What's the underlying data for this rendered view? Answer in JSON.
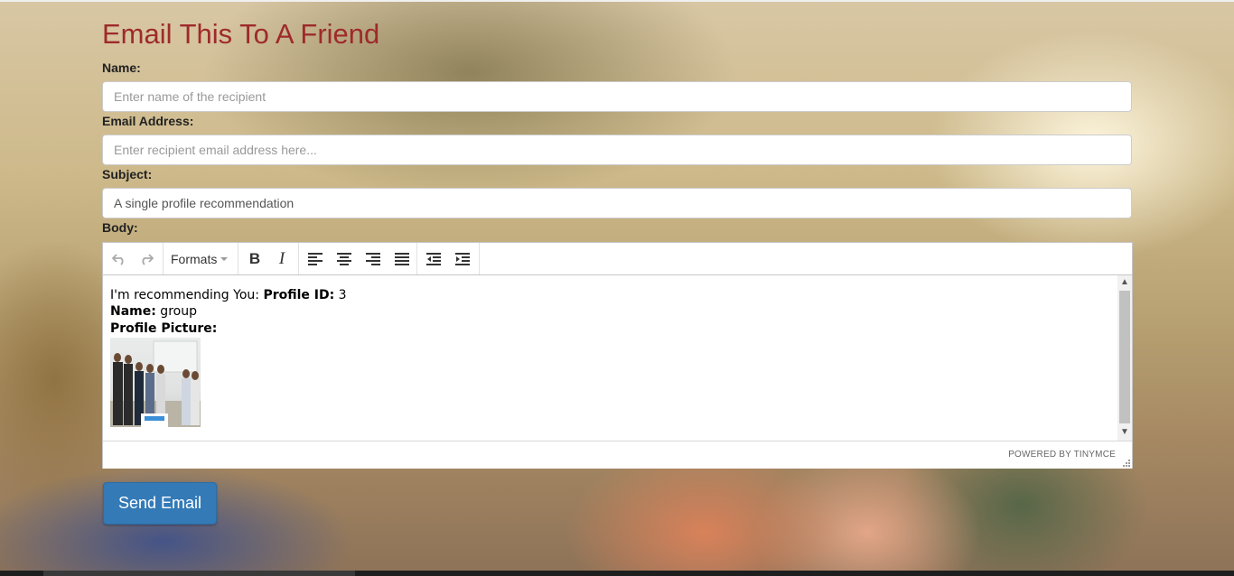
{
  "page": {
    "title": "Email This To A Friend"
  },
  "form": {
    "name_label": "Name:",
    "name_placeholder": "Enter name of the recipient",
    "name_value": "",
    "email_label": "Email Address:",
    "email_placeholder": "Enter recipient email address here...",
    "email_value": "",
    "subject_label": "Subject:",
    "subject_value": "A single profile recommendation",
    "body_label": "Body:"
  },
  "editor": {
    "toolbar": {
      "undo_icon": "undo-icon",
      "redo_icon": "redo-icon",
      "formats_label": "Formats",
      "bold_label": "B",
      "italic_label": "I"
    },
    "content": {
      "line1_prefix": "I'm recommending You: ",
      "profile_id_label": "Profile ID:",
      "profile_id_value": " 3",
      "name_label": "Name:",
      "name_value": " group",
      "picture_label": "Profile Picture:"
    },
    "powered_by": "POWERED BY TINYMCE"
  },
  "actions": {
    "send_label": "Send Email"
  },
  "colors": {
    "title": "#9e2a2a",
    "primary_button": "#337ab7"
  }
}
